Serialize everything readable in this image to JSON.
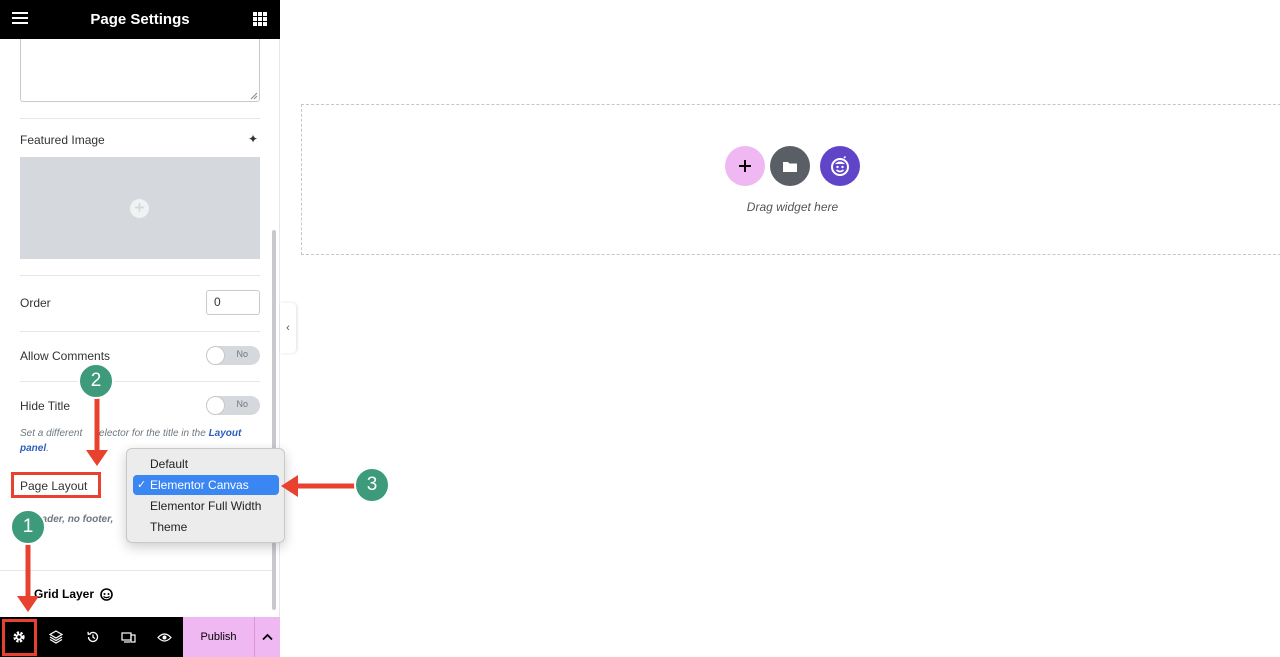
{
  "header": {
    "title": "Page Settings"
  },
  "fields": {
    "featured_image_label": "Featured Image",
    "order_label": "Order",
    "order_value": "0",
    "allow_comments_label": "Allow Comments",
    "allow_comments_state": "No",
    "hide_title_label": "Hide Title",
    "hide_title_state": "No",
    "hide_title_help_prefix": "Set a different",
    "hide_title_help_middle": "elector for the title in the",
    "hide_title_help_link": "Layout panel",
    "hide_title_help_suffix": ".",
    "page_layout_label": "Page Layout",
    "page_layout_desc": "eader, no footer, ",
    "grid_layer_label": "Grid Layer"
  },
  "dropdown": {
    "options": [
      "Default",
      "Elementor Canvas",
      "Elementor Full Width",
      "Theme"
    ],
    "selected": "Elementor Canvas",
    "check_glyph": "✓"
  },
  "canvas": {
    "drag_text": "Drag widget here"
  },
  "toolbar": {
    "publish_label": "Publish"
  },
  "annotations": {
    "badges": [
      "1",
      "2",
      "3"
    ]
  },
  "colors": {
    "accent_pink": "#f0b8f3",
    "ai_purple": "#6045c8",
    "annotation_red": "#e8412f",
    "annotation_teal": "#3d9a7b",
    "select_blue": "#3a86f3"
  }
}
